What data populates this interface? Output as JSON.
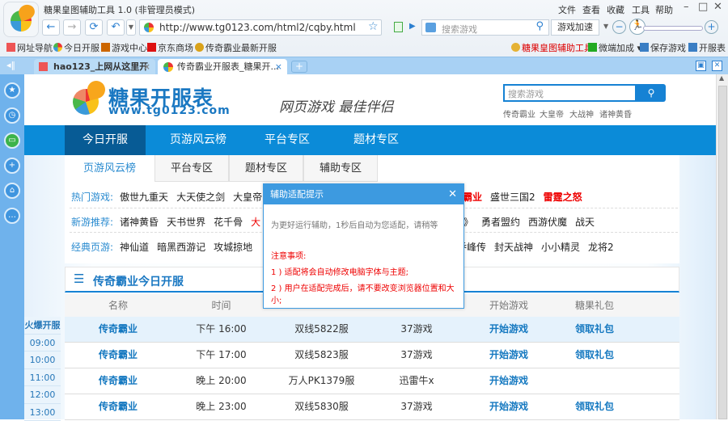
{
  "window": {
    "title": "糖果皇图辅助工具 1.0 (非管理员模式)",
    "menu": [
      "文件",
      "查看",
      "收藏",
      "工具",
      "帮助"
    ]
  },
  "toolbar": {
    "url": "http://www.tg0123.com/html2/cqby.html",
    "search_placeholder": "搜索游戏",
    "accel_label": "游戏加速"
  },
  "bookmarks": [
    "网址导航",
    "今日开服",
    "游戏中心",
    "京东商场",
    "传奇霸业最新开服"
  ],
  "right_tools": {
    "helper": "糖果皇图辅助工具",
    "weiduan": "微端加成",
    "save": "保存游戏",
    "table": "开服表"
  },
  "tabs": [
    {
      "label": "hao123_上网从这里开始"
    },
    {
      "label": "传奇霸业开服表_糖果开..."
    }
  ],
  "site": {
    "name": "糖果开服表",
    "url": "www.tg0123.com",
    "slogan": "网页游戏 最佳伴侣",
    "search_placeholder": "搜索游戏",
    "hot_searches": [
      "传奇霸业",
      "大皇帝",
      "大战神",
      "诸神黄昏"
    ]
  },
  "nav": [
    "今日开服",
    "页游风云榜",
    "平台专区",
    "题材专区"
  ],
  "subtabs": [
    "页游风云榜",
    "平台专区",
    "题材专区",
    "辅助专区"
  ],
  "groups": [
    {
      "label": "热门游戏:",
      "left": [
        "傲世九重天",
        "大天使之剑",
        "大皇帝"
      ],
      "right": [
        {
          "t": "霸业",
          "red": true
        },
        {
          "t": "盛世三国2"
        },
        {
          "t": "雷霆之怒",
          "red": true
        }
      ]
    },
    {
      "label": "新游推荐:",
      "left": [
        "诸神黄昏",
        "天书世界",
        "花千骨"
      ],
      "left_red": "大",
      "right": [
        {
          "t": "》"
        },
        {
          "t": "勇者盟约"
        },
        {
          "t": "西游伏魔"
        },
        {
          "t": "战天"
        }
      ]
    },
    {
      "label": "经典页游:",
      "left": [
        "神仙道",
        "暗黑西游记",
        "攻城掠地"
      ],
      "right": [
        {
          "t": "乔峰传"
        },
        {
          "t": "封天战神"
        },
        {
          "t": "小小精灵"
        },
        {
          "t": "龙将2"
        }
      ]
    }
  ],
  "section_title": "传奇霸业今日开服",
  "table": {
    "headers": [
      "名称",
      "时间",
      "",
      "",
      "开始游戏",
      "糖果礼包"
    ],
    "rows": [
      [
        "传奇霸业",
        "下午 16:00",
        "双线5822服",
        "37游戏",
        "开始游戏",
        "领取礼包"
      ],
      [
        "传奇霸业",
        "下午 17:00",
        "双线5823服",
        "37游戏",
        "开始游戏",
        "领取礼包"
      ],
      [
        "传奇霸业",
        "晚上 20:00",
        "万人PK1379服",
        "迅雷牛x",
        "开始游戏",
        ""
      ],
      [
        "传奇霸业",
        "晚上 23:00",
        "双线5830服",
        "37游戏",
        "开始游戏",
        "领取礼包"
      ]
    ]
  },
  "timeline": [
    "火爆开服",
    "09:00",
    "10:00",
    "11:00",
    "12:00",
    "13:00"
  ],
  "dialog": {
    "title": "辅助适配提示",
    "message": "为更好运行辅助，1秒后自动为您适配，请稍等",
    "notice": "注意事项:",
    "items": [
      "1 ) 适配将会自动修改电脑字体与主题;",
      "2 ) 用户在适配完成后，请不要改变浏览器位置和大小;"
    ]
  }
}
